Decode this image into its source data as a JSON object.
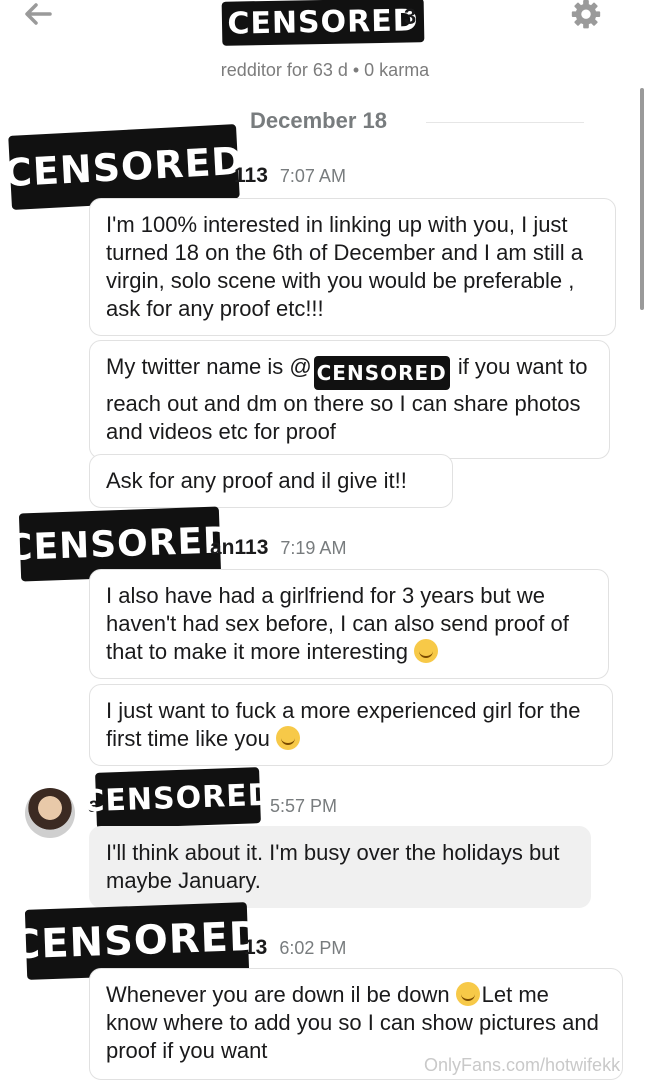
{
  "header": {
    "censor_label": "CENSORED",
    "title_suffix": "3",
    "subtitle": "redditor for 63 d • 0 karma"
  },
  "date_divider": "December 18",
  "groups": [
    {
      "username_suffix": "113",
      "time": "7:07 AM",
      "messages": [
        "I'm 100% interested in linking up with you, I just turned 18 on the 6th of December and I am still a virgin, solo scene with you would be preferable , ask for any proof etc!!!",
        {
          "before": "My twitter name is @",
          "after": " if you want to reach out and dm on there so I can share photos and videos etc for proof"
        },
        "Ask for any proof and il give it!!"
      ]
    },
    {
      "username_suffix": "an113",
      "time": "7:19 AM",
      "messages": [
        "I also have had a girlfriend for 3 years but we haven't had sex before, I can also send proof of that to make it more interesting",
        "I just want to fuck a more experienced girl for the first time like you"
      ]
    },
    {
      "username_prefix": "a",
      "time": "5:57 PM",
      "messages": [
        "I'll think about it. I'm busy over the holidays but maybe January."
      ]
    },
    {
      "username_suffix": "13",
      "time": "6:02 PM",
      "messages": [
        {
          "before": "Whenever you are down il be down",
          "after": "Let me know where to add you so I can show pictures and proof if you want"
        }
      ]
    }
  ],
  "watermark": "OnlyFans.com/hotwifekk",
  "icons": {
    "back": "arrow-left-icon",
    "settings": "gear-icon",
    "emoji1": "rofl-emoji-icon",
    "emoji2": "wink-emoji-icon",
    "emoji3": "laughing-emoji-icon"
  }
}
